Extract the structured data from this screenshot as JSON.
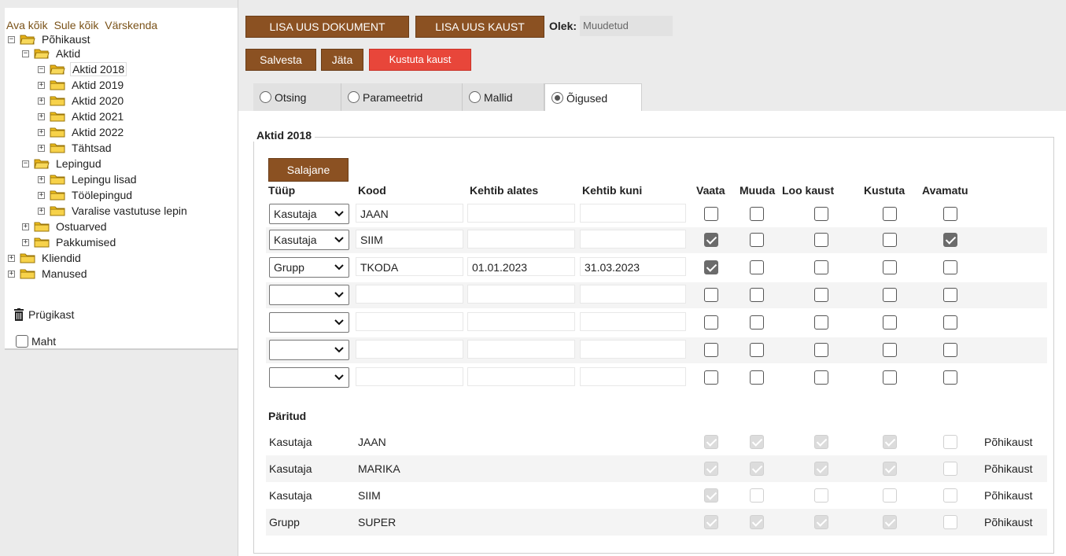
{
  "sidebar": {
    "links": [
      "Ava kõik",
      "Sule kõik",
      "Värskenda"
    ],
    "tree": [
      {
        "label": "Põhikaust",
        "toggle": "−"
      },
      {
        "label": "Aktid",
        "toggle": "−"
      },
      {
        "label": "Aktid 2018",
        "toggle": "−"
      },
      {
        "label": "Aktid 2019",
        "toggle": "+"
      },
      {
        "label": "Aktid 2020",
        "toggle": "+"
      },
      {
        "label": "Aktid 2021",
        "toggle": "+"
      },
      {
        "label": "Aktid 2022",
        "toggle": "+"
      },
      {
        "label": "Tähtsad",
        "toggle": "+"
      },
      {
        "label": "Lepingud",
        "toggle": "−"
      },
      {
        "label": "Lepingu lisad",
        "toggle": "+"
      },
      {
        "label": "Töölepingud",
        "toggle": "+"
      },
      {
        "label": "Varalise vastutuse lepin",
        "toggle": "+"
      },
      {
        "label": "Ostuarved",
        "toggle": "+"
      },
      {
        "label": "Pakkumised",
        "toggle": "+"
      },
      {
        "label": "Kliendid",
        "toggle": "+"
      },
      {
        "label": "Manused",
        "toggle": "+"
      }
    ],
    "trash_label": "Prügikast",
    "maht_label": "Maht"
  },
  "toolbar": {
    "new_document": "LISA UUS DOKUMENT",
    "new_folder": "LISA UUS KAUST",
    "status_label": "Olek:",
    "status_value": "Muudetud",
    "save": "Salvesta",
    "leave": "Jäta",
    "delete_folder": "Kustuta kaust"
  },
  "tabs": [
    {
      "label": "Otsing",
      "active": false
    },
    {
      "label": "Parameetrid",
      "active": false
    },
    {
      "label": "Mallid",
      "active": false
    },
    {
      "label": "Õigused",
      "active": true
    }
  ],
  "permissions": {
    "folder_title": "Aktid 2018",
    "secret_button": "Salajane",
    "headers": [
      "Tüüp",
      "Kood",
      "Kehtib alates",
      "Kehtib kuni",
      "Vaata",
      "Muuda",
      "Loo kaust",
      "Kustuta",
      "Avamatu"
    ],
    "rows": [
      {
        "type": "Kasutaja",
        "code": "JAAN",
        "from": "",
        "to": "",
        "flags": [
          false,
          false,
          false,
          false,
          false
        ]
      },
      {
        "type": "Kasutaja",
        "code": "SIIM",
        "from": "",
        "to": "",
        "flags": [
          true,
          false,
          false,
          false,
          true
        ]
      },
      {
        "type": "Grupp",
        "code": "TKODA",
        "from": "01.01.2023",
        "to": "31.03.2023",
        "flags": [
          true,
          false,
          false,
          false,
          false
        ]
      },
      {
        "type": "",
        "code": "",
        "from": "",
        "to": "",
        "flags": [
          false,
          false,
          false,
          false,
          false
        ]
      },
      {
        "type": "",
        "code": "",
        "from": "",
        "to": "",
        "flags": [
          false,
          false,
          false,
          false,
          false
        ]
      },
      {
        "type": "",
        "code": "",
        "from": "",
        "to": "",
        "flags": [
          false,
          false,
          false,
          false,
          false
        ]
      },
      {
        "type": "",
        "code": "",
        "from": "",
        "to": "",
        "flags": [
          false,
          false,
          false,
          false,
          false
        ]
      }
    ],
    "inherited_title": "Päritud",
    "inherited": [
      {
        "type": "Kasutaja",
        "code": "JAAN",
        "flags": [
          true,
          true,
          true,
          true,
          false
        ],
        "source": "Põhikaust"
      },
      {
        "type": "Kasutaja",
        "code": "MARIKA",
        "flags": [
          true,
          true,
          true,
          true,
          false
        ],
        "source": "Põhikaust"
      },
      {
        "type": "Kasutaja",
        "code": "SIIM",
        "flags": [
          true,
          false,
          false,
          false,
          false
        ],
        "source": "Põhikaust"
      },
      {
        "type": "Grupp",
        "code": "SUPER",
        "flags": [
          true,
          true,
          true,
          true,
          false
        ],
        "source": "Põhikaust"
      }
    ]
  },
  "colors": {
    "brown_button": "#8b5122",
    "red_button": "#e8463a",
    "link": "#7a5218",
    "folder": "#f2c21a"
  }
}
